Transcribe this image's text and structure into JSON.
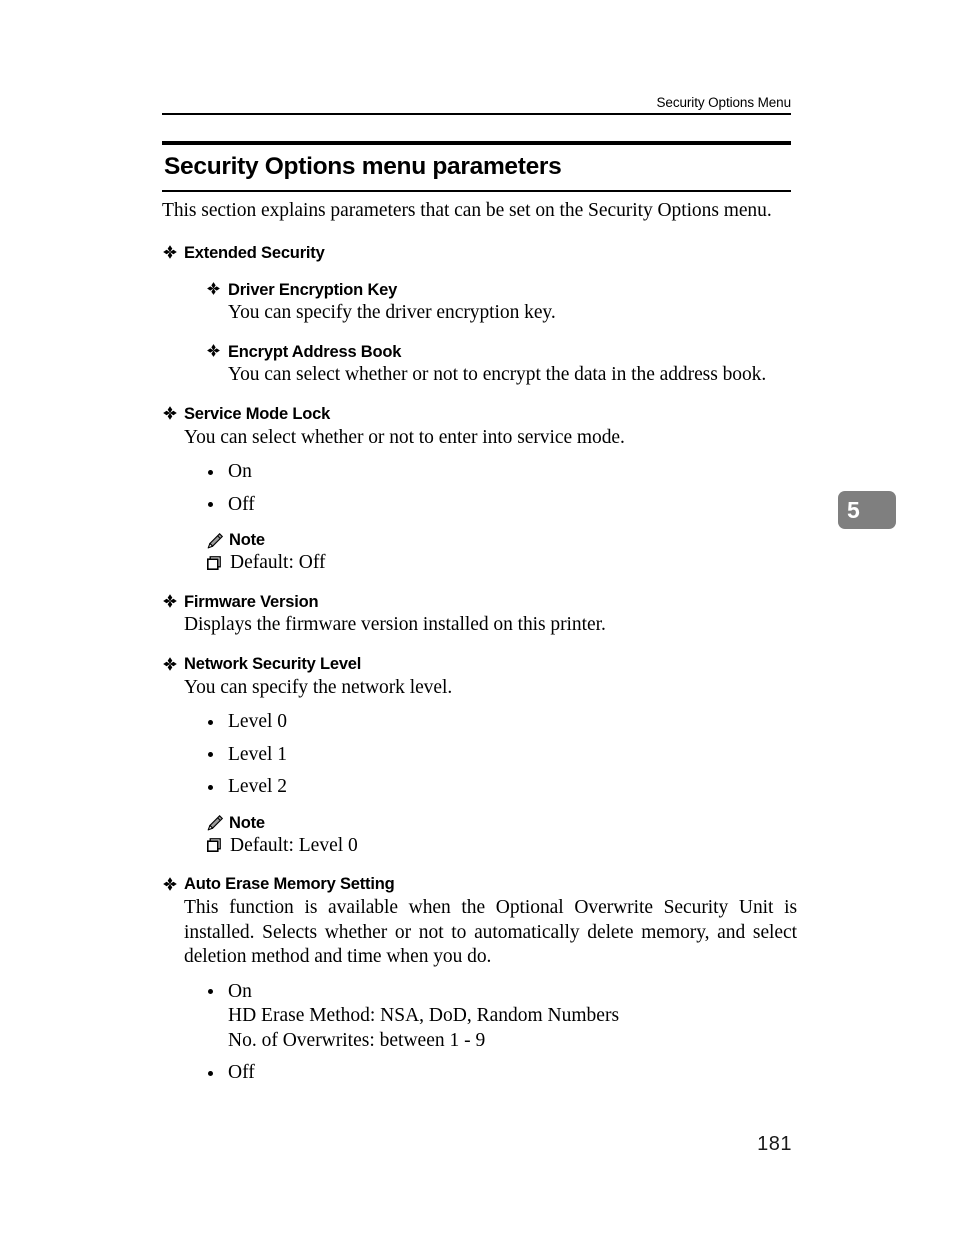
{
  "header": {
    "running_head": "Security Options Menu"
  },
  "title": {
    "text": "Security Options menu parameters"
  },
  "intro": "This section explains parameters that can be set on the Security Options menu.",
  "sections": [
    {
      "title": "Extended Security",
      "subsections": [
        {
          "title": "Driver Encryption Key",
          "desc": "You can specify the driver encryption key."
        },
        {
          "title": "Encrypt Address Book",
          "desc": "You can select whether or not to encrypt the data in the address book."
        }
      ]
    },
    {
      "title": "Service Mode Lock",
      "desc": "You can select whether or not to enter into service mode.",
      "options": [
        "On",
        "Off"
      ],
      "note": {
        "label": "Note",
        "items": [
          "Default: Off"
        ]
      }
    },
    {
      "title": "Firmware Version",
      "desc": "Displays the firmware version installed on this printer."
    },
    {
      "title": "Network Security Level",
      "desc": "You can specify the network level.",
      "options": [
        "Level 0",
        "Level 1",
        "Level 2"
      ],
      "note": {
        "label": "Note",
        "items": [
          "Default: Level 0"
        ]
      }
    },
    {
      "title": "Auto Erase Memory Setting",
      "desc": "This function is available when the Optional Overwrite Security Unit is installed. Selects whether or not to automatically delete memory, and select deletion method and time when you do.",
      "options": [
        "On",
        "Off"
      ],
      "option_details": {
        "on_line1": "HD Erase Method: NSA, DoD, Random Numbers",
        "on_line2": "No. of Overwrites: between 1 - 9"
      }
    }
  ],
  "chapter_tab": {
    "number": "5",
    "color": "#7f7f7f"
  },
  "page_number": "181"
}
